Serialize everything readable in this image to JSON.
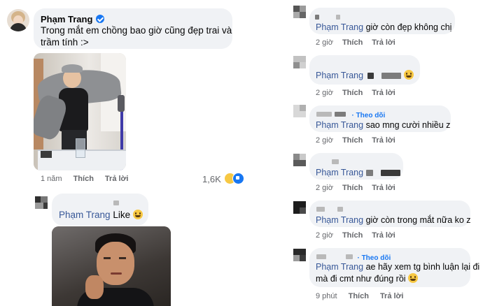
{
  "left": {
    "post": {
      "author": "Phạm Trang",
      "text_line1": "Trong mắt em chồng bao giờ cũng đẹp trai và",
      "text_line2": "trầm tính :>",
      "time": "1 năm",
      "like": "Thích",
      "reply": "Trả lời",
      "reaction_count": "1,6K"
    },
    "reply": {
      "mention": "Phạm Trang",
      "text": "Like"
    }
  },
  "right": {
    "comments": [
      {
        "mention": "Phạm Trang",
        "text": "giờ còn đẹp không chị",
        "time": "2 giờ",
        "like": "Thích",
        "reply": "Trả lời"
      },
      {
        "mention": "Phạm Trang",
        "text": "",
        "time": "2 giờ",
        "like": "Thích",
        "reply": "Trả lời"
      },
      {
        "follow": "Theo dõi",
        "mention": "Phạm Trang",
        "text": "sao mng cười nhiều z",
        "time": "2 giờ",
        "like": "Thích",
        "reply": "Trả lời"
      },
      {
        "mention": "Phạm Trang",
        "text": "",
        "time": "2 giờ",
        "like": "Thích",
        "reply": "Trả lời"
      },
      {
        "mention": "Phạm Trang",
        "text": "giờ còn trong mắt nữa ko z",
        "time": "2 giờ",
        "like": "Thích",
        "reply": "Trả lời"
      },
      {
        "follow": "Theo dõi",
        "mention": "Phạm Trang",
        "text": "ae hãy xem tg bình luận lại đi",
        "text2": "mà đi cmt như đúng rồi",
        "time": "9 phút",
        "like": "Thích",
        "reply": "Trả lời"
      }
    ]
  },
  "colors": {
    "mention": "#385898",
    "bubble": "#f0f2f5",
    "follow": "#1877f2",
    "meta": "#65676b"
  }
}
